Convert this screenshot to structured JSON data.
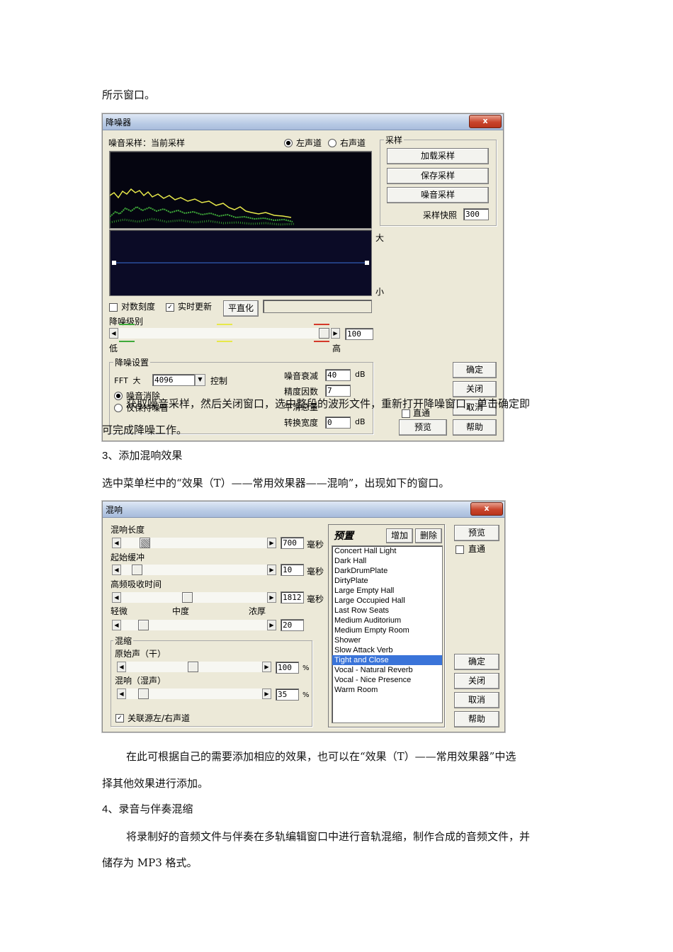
{
  "doc": {
    "p_intro": "所示窗口。",
    "p_overlap_line1": "获取噪音采样，然后关闭窗口，选中整段的波形文件，重新打开降噪窗口，单击确定即",
    "p_overlap_line2": "可完成降噪工作。",
    "h3": "3、添加混响效果",
    "p_menu": "选中菜单栏中的“效果（T）——常用效果器——混响”，出现如下的窗口。",
    "p_after_line1": "在此可根据自己的需要添加相应的效果，也可以在“效果（T）——常用效果器”中选",
    "p_after_line2": "择其他效果进行添加。",
    "h4": "4、录音与伴奏混缩",
    "p_last_line1": "将录制好的音频文件与伴奏在多轨编辑窗口中进行音轨混缩，制作合成的音频文件，并",
    "p_last_line2": "储存为 MP3 格式。"
  },
  "nr": {
    "title": "降噪器",
    "close": "x",
    "noise_sample_label": "噪音采样：当前采样",
    "left_channel": "左声道",
    "right_channel": "右声道",
    "sample_group": "采样",
    "btn_load": "加载采样",
    "btn_save": "保存采样",
    "btn_noise": "噪音采样",
    "snapshot_label": "采样快照",
    "snapshot_value": "300",
    "big": "大",
    "small": "小",
    "log_scale": "对数刻度",
    "realtime": "实时更新",
    "btn_flatten": "平直化",
    "level_label": "降噪级别",
    "level_low": "低",
    "level_high": "高",
    "level_value": "100",
    "settings_group": "降噪设置",
    "fft_label": "FFT 大",
    "fft_value": "4096",
    "control_label": "控制",
    "remove_noise": "噪音消除",
    "keep_noise": "仅保持噪音",
    "decay_label": "噪音衰减",
    "decay_value": "40",
    "db1": "dB",
    "precision_label": "精度因数",
    "precision_value": "7",
    "smooth_label": "平滑总量",
    "transition_label": "转换宽度",
    "transition_value": "0",
    "db2": "dB",
    "btn_ok": "确定",
    "btn_close": "关闭",
    "btn_cancel": "取消",
    "bypass": "直通",
    "btn_preview": "预览",
    "btn_help": "帮助"
  },
  "rv": {
    "title": "混响",
    "close": "x",
    "length_label": "混响长度",
    "length_value": "700",
    "attack_label": "起始缓冲",
    "attack_value": "10",
    "hf_label": "高频吸收时间",
    "hf_value": "1812",
    "unit_ms": "毫秒",
    "light": "轻微",
    "medium": "中度",
    "heavy": "浓厚",
    "depth_value": "20",
    "mix_group": "混缩",
    "dry_label": "原始声（干）",
    "dry_value": "100",
    "wet_label": "混响（湿声）",
    "wet_value": "35",
    "pct": "%",
    "link": "关联源左/右声道",
    "presets_label": "预置",
    "btn_add": "增加",
    "btn_delete": "删除",
    "presets": [
      "Concert Hall Light",
      "Dark Hall",
      "DarkDrumPlate",
      "DirtyPlate",
      "Large Empty Hall",
      "Large Occupied Hall",
      "Last Row Seats",
      "Medium Auditorium",
      "Medium Empty Room",
      "Shower",
      "Slow Attack Verb",
      "Tight and Close",
      "Vocal - Natural Reverb",
      "Vocal - Nice Presence",
      "Warm Room"
    ],
    "selected_preset": "Tight and Close",
    "btn_preview": "预览",
    "bypass": "直通",
    "btn_ok": "确定",
    "btn_close": "关闭",
    "btn_cancel": "取消",
    "btn_help": "帮助"
  },
  "colors": {
    "spectrum_bg": "#050510",
    "graph_bg": "#0b0b26",
    "graph_line": "#3a6fd8",
    "yellow_trace": "#e7e84a",
    "green_trace": "#3faa3a",
    "selection": "#3a74d9"
  }
}
